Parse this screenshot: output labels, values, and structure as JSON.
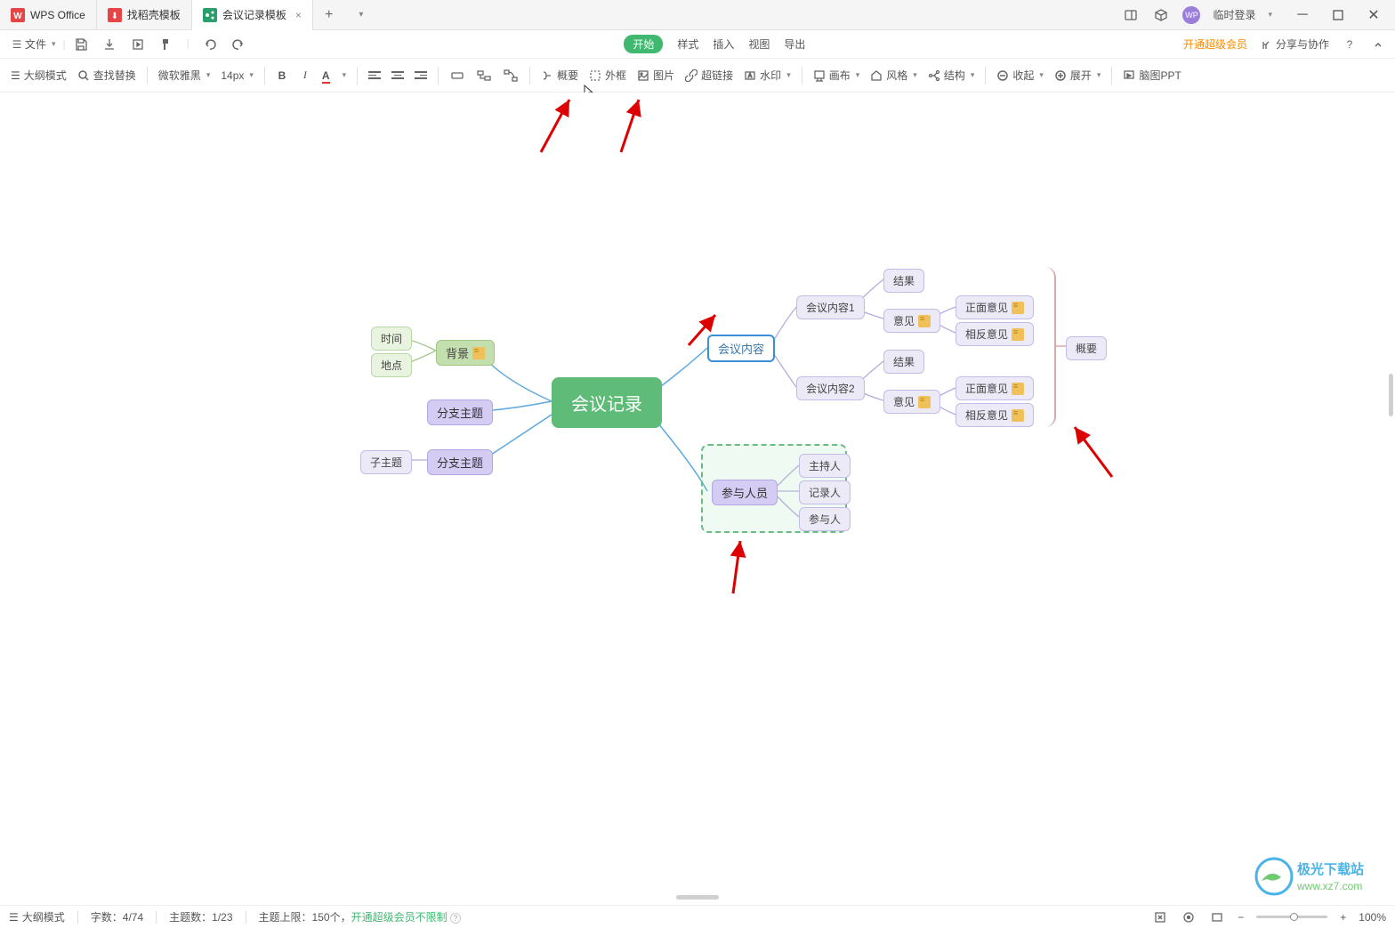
{
  "titlebar": {
    "tabs": [
      {
        "label": "WPS Office",
        "icon": "W"
      },
      {
        "label": "找稻壳模板",
        "icon": "⬇"
      },
      {
        "label": "会议记录模板",
        "icon": "📊"
      }
    ],
    "login": "临时登录"
  },
  "menubar": {
    "file": "文件",
    "items": [
      "开始",
      "样式",
      "插入",
      "视图",
      "导出"
    ],
    "vip": "开通超级会员",
    "share": "分享与协作"
  },
  "toolbar": {
    "outline": "大纲模式",
    "search": "查找替换",
    "font": "微软雅黑",
    "size": "14px",
    "summary": "概要",
    "boundary": "外框",
    "image": "图片",
    "link": "超链接",
    "watermark": "水印",
    "canvas": "画布",
    "style": "风格",
    "structure": "结构",
    "collapse": "收起",
    "expand": "展开",
    "ppt": "脑图PPT"
  },
  "mindmap": {
    "root": "会议记录",
    "left": {
      "bg": "背景",
      "time": "时间",
      "place": "地点",
      "branch1": "分支主题",
      "branch2": "分支主题",
      "child": "子主题"
    },
    "right": {
      "content": "会议内容",
      "content1": "会议内容1",
      "content2": "会议内容2",
      "result": "结果",
      "opinion": "意见",
      "pos": "正面意见",
      "neg": "相反意见",
      "people": "参与人员",
      "host": "主持人",
      "recorder": "记录人",
      "attendee": "参与人",
      "summary": "概要"
    }
  },
  "statusbar": {
    "outline": "大纲模式",
    "words_label": "字数：",
    "words": "4/74",
    "topics_label": "主题数：",
    "topics": "1/23",
    "limit_label": "主题上限：",
    "limit": "150个，",
    "limit_link": "开通超级会员不限制",
    "zoom": "100%"
  },
  "watermark": {
    "line1": "极光下载站",
    "line2": "www.xz7.com"
  }
}
